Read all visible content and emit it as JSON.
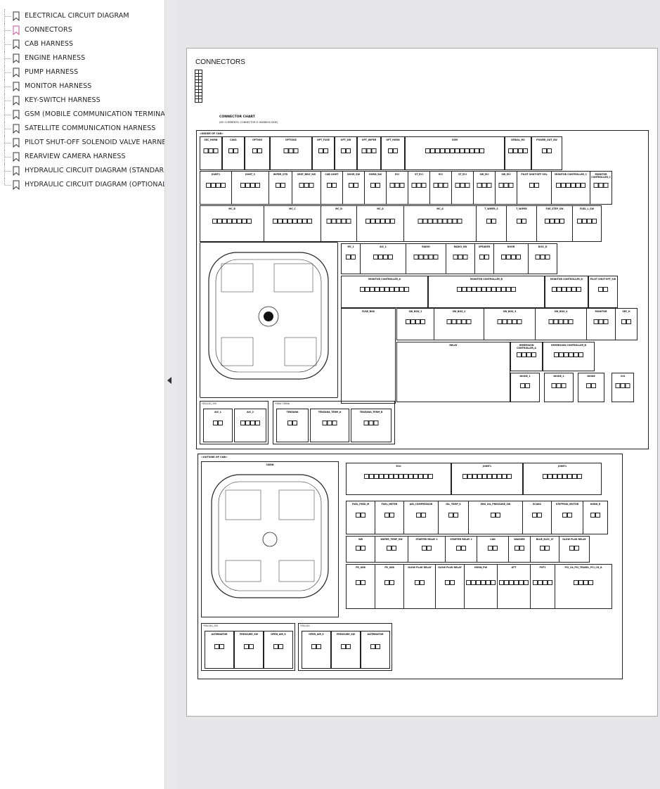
{
  "bookmarks": [
    {
      "label": "ELECTRICAL CIRCUIT DIAGRAM",
      "active": false
    },
    {
      "label": "CONNECTORS",
      "active": true
    },
    {
      "label": "CAB HARNESS",
      "active": false
    },
    {
      "label": "ENGINE HARNESS",
      "active": false
    },
    {
      "label": "PUMP HARNESS",
      "active": false
    },
    {
      "label": "MONITOR HARNESS",
      "active": false
    },
    {
      "label": "KEY-SWITCH HARNESS",
      "active": false
    },
    {
      "label": "GSM (MOBILE COMMUNICATION TERMINAL) HAR",
      "active": false
    },
    {
      "label": "SATELLITE COMMUNICATION HARNESS",
      "active": false
    },
    {
      "label": "PILOT SHUT-OFF SOLENOID VALVE HARNESS",
      "active": false
    },
    {
      "label": "REARVIEW CAMERA HARNESS",
      "active": false
    },
    {
      "label": "HYDRAULIC CIRCUIT DIAGRAM (STANDARD)",
      "active": false
    },
    {
      "label": "HYDRAULIC CIRCUIT DIAGRAM (OPTIONAL)",
      "active": false
    }
  ],
  "colors": {
    "active_bookmark": "#c0509a",
    "bookmark": "#333333"
  },
  "document": {
    "title": "CONNECTORS",
    "chart_title": "CONNECTOR CHART",
    "chart_note": "(NO COMMENTS: CONNECTOR IS HARNESS SIDE)",
    "inside_label": "<INSIDE OF CAB>",
    "outside_label": "<OUTSIDE OF CAB>",
    "fuse_box_label": "FUSE_BOX",
    "ecu_label": "ECU",
    "cabin_label": "CABIN",
    "relay_label": "RELAY",
    "connector_names_top": [
      "SEC_HORN",
      "CAN1",
      "OPTION",
      "OPTION2",
      "OPT_FUSE",
      "OPT_SW",
      "OPT_WIPER",
      "OPT_HORN",
      "GSM",
      "SERIAL_MC",
      "POWER_OUT_SW"
    ],
    "connector_names_row2": [
      "JOINT1",
      "JOINT_3",
      "WIPER_STD",
      "SEAT_BELT_SW",
      "CAB LIGHT",
      "DOOR_SW",
      "HORN_SW",
      "ECI",
      "ST_ECI",
      "ECI",
      "ST_ECI",
      "SW_ECI",
      "SW_ECI",
      "PILOT SHUT-OFF SOL",
      "MONITOR CONTROLLER_C",
      "MONITOR CONTROLLER_C"
    ],
    "connector_names_row3": [
      "MC_B",
      "MC_C",
      "MC_D",
      "MC_A",
      "MC_A",
      "T_WIPER_S",
      "T_WIPER",
      "FUE_STEP_SW",
      "FUEL_L_SW"
    ],
    "connector_names_row4": [
      "MC_1",
      "AIC_1",
      "RADIO",
      "RADIO_SW",
      "SPEAKER",
      "DOOR",
      "DISC_D"
    ],
    "connector_names_row5": [
      "MONITOR CONTROLLER_A",
      "MONITOR CONTROLLER_B",
      "MONITOR CONTROLLER_D",
      "PILOT SHUT-OFF_SW"
    ],
    "connector_names_row6": [
      "SW_BOX_1",
      "SW_BOX_2",
      "SW_BOX_3",
      "SW_BOX_4",
      "MONITOR",
      "SEC_H"
    ],
    "connector_names_row7": [
      "IMMERSION CONTROLLER_A",
      "IMMERSION CONTROLLER_B",
      "DIODE_1",
      "DIODE_2",
      "DIODE",
      "CIG"
    ],
    "bottom_inside_a": "*SSL140_150",
    "bottom_inside_b": "*ONLY CHINA",
    "bottom_inside_names": [
      "AIC_1",
      "AIC_2",
      "TENZANA",
      "TENZANA_TERM_A",
      "TENZANA_TERM_B"
    ],
    "outside_names": [
      "ECU",
      "JOINT1",
      "JOINT1",
      "FUEL_FEED_M",
      "FUEL_METER",
      "AIR_COMPRESSOR",
      "OIL_TEMP_S",
      "ENG_OIL_PRESSURE_SW",
      "ECAN2",
      "STEPPING_MOTOR",
      "HORN_R",
      "WB",
      "WATER_TEMP_SW",
      "STARTER RELAY 1",
      "STARTER RELAY 2",
      "CAN",
      "WASHER",
      "BLUE_ELEC_LT",
      "GLOW PLUG RELAY",
      "FR_USB",
      "FR_USB",
      "GLOW PLUG RELAY",
      "GLOW PLUG RELAY",
      "HORN_PW",
      "ATT",
      "PCF1",
      "PCI_CA_PCI_TRAVEL_PCI_CH_A"
    ],
    "outside_bottom_a": "*SSL140_150",
    "outside_bottom_b": "*SSL140",
    "outside_bottom_names": [
      "ALTERNATOR",
      "PRESSURE_SW",
      "OPEN_AIR_S",
      "OPEN_AIR_S",
      "PRESSURE_SW",
      "ALTERNATOR"
    ]
  }
}
